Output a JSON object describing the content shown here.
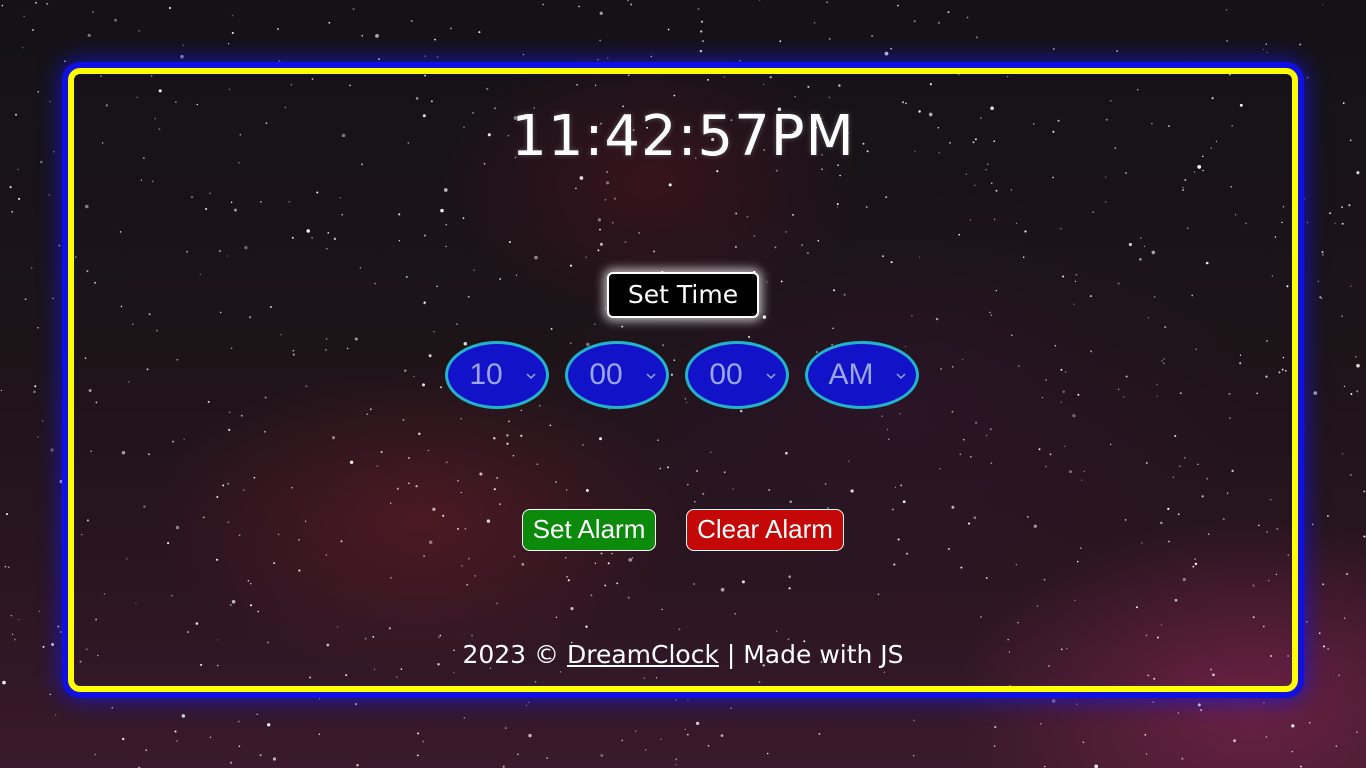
{
  "clock": {
    "time": "11:42:57PM"
  },
  "set_time": {
    "label": "Set Time"
  },
  "selects": {
    "hour": "10",
    "minute": "00",
    "second": "00",
    "ampm": "AM"
  },
  "buttons": {
    "set_alarm": "Set Alarm",
    "clear_alarm": "Clear Alarm"
  },
  "footer": {
    "prefix": "2023 © ",
    "brand": "DreamClock",
    "suffix": " | Made with JS"
  },
  "colors": {
    "frame_border": "#ffff00",
    "frame_glow": "#1010e0",
    "select_bg": "#1212c8",
    "select_border": "#22b4c8",
    "set_alarm_bg": "#0b8a0b",
    "clear_alarm_bg": "#c40707"
  },
  "icons": {
    "select_arrow": "chevron-down-icon"
  }
}
